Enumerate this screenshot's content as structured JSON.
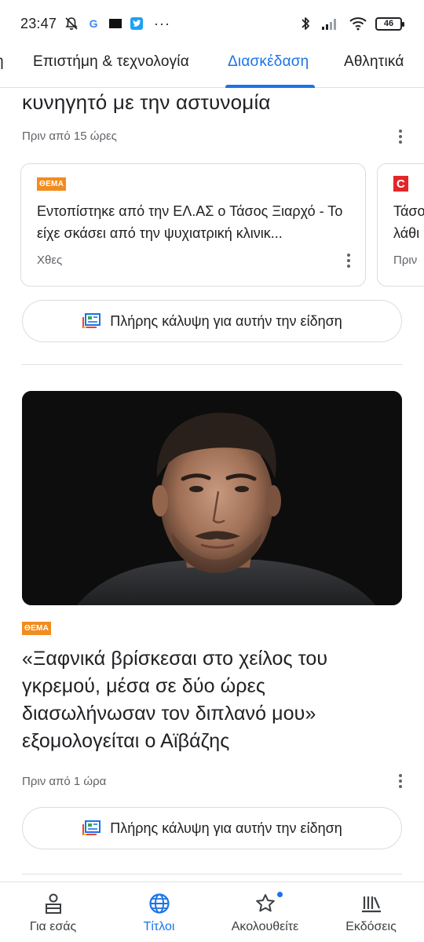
{
  "status_bar": {
    "time": "23:47",
    "notification_icons": [
      "muted-bell-icon",
      "google-icon",
      "news-app-icon",
      "twitter-icon"
    ],
    "more": "···",
    "battery": "46"
  },
  "tabs": [
    {
      "label": "η"
    },
    {
      "label": "Επιστήμη & τεχνολογία"
    },
    {
      "label": "Διασκέδαση",
      "active": true
    },
    {
      "label": "Αθλητικά"
    }
  ],
  "story1": {
    "headline_tail": "κυνηγητό με την αστυνομία",
    "time": "Πριν από 15 ώρες",
    "related": [
      {
        "source_logo": "ΘΕΜΑ",
        "title": "Εντοπίστηκε από την ΕΛ.ΑΣ ο Τάσος Ξιαρχό - Το είχε σκάσει από την ψυχιατρική κλινικ...",
        "time": "Χθες"
      },
      {
        "source_logo": "C",
        "title_line1": "Τάσο",
        "title_line2": "λάθι",
        "time": "Πριν"
      }
    ],
    "coverage_label": "Πλήρης κάλυψη για αυτήν την είδηση"
  },
  "story2": {
    "source_logo": "ΘΕΜΑ",
    "headline": "«Ξαφνικά βρίσκεσαι στο χείλος του γκρεμού, μέσα σε δύο ώρες διασωλήνωσαν τον διπλανό μου» εξομολογείται ο Αϊβάζης",
    "time": "Πριν από 1 ώρα",
    "coverage_label": "Πλήρης κάλυψη για αυτήν την είδηση"
  },
  "bottom_nav": [
    {
      "label": "Για εσάς",
      "icon": "for-you-icon"
    },
    {
      "label": "Τίτλοι",
      "icon": "globe-icon",
      "active": true
    },
    {
      "label": "Ακολουθείτε",
      "icon": "star-icon",
      "badge": true
    },
    {
      "label": "Εκδόσεις",
      "icon": "newsstand-icon"
    }
  ],
  "colors": {
    "accent": "#1a73e8",
    "text": "#202124",
    "secondary_text": "#5f6368",
    "border": "#dadce0",
    "protothema_orange": "#f28c1e"
  }
}
